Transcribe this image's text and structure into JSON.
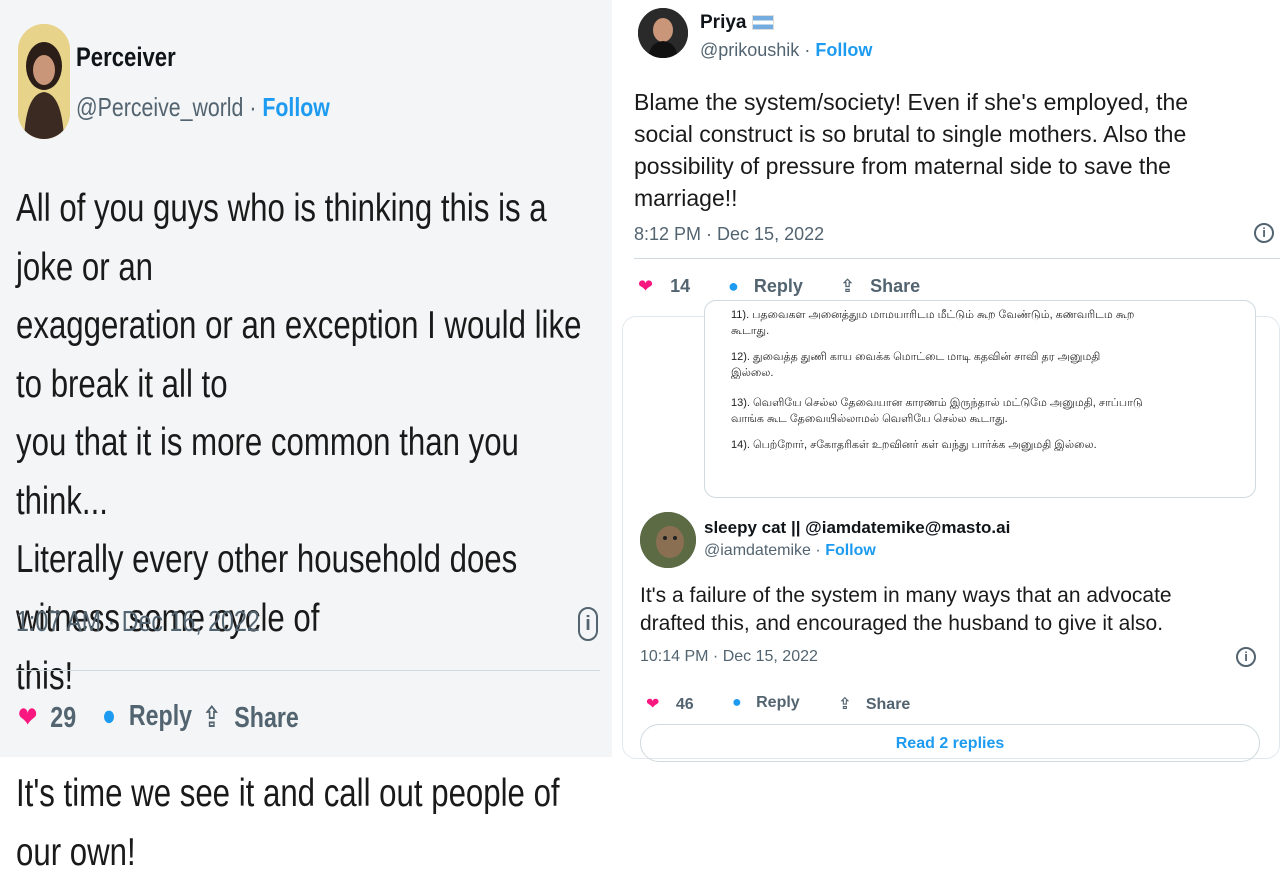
{
  "left_tweet": {
    "author_name": "Perceiver",
    "handle": "@Perceive_world",
    "separator": "·",
    "follow_label": "Follow",
    "body": "All of you guys who is thinking this is a joke or an\nexaggeration or an exception I would like to break it all to\nyou that it is more common than you think...\nLiterally every other household does witness some cycle of\nthis!\n\nIt's time we see it and call out people of our own!",
    "timestamp": "1:07 AM · Dec 16, 2022",
    "likes": "29",
    "reply_label": "Reply",
    "share_label": "Share"
  },
  "right_tweet": {
    "author_name": "Priya",
    "handle": "@prikoushik",
    "separator": "·",
    "follow_label": "Follow",
    "body": "Blame the system/society! Even if she's employed, the\nsocial construct is so brutal to single mothers. Also the\npossibility of pressure from maternal side to save the\nmarriage!!",
    "timestamp": "8:12 PM · Dec 15, 2022",
    "likes": "14",
    "reply_label": "Reply",
    "share_label": "Share"
  },
  "quoted_image": {
    "lines": [
      "11). பதவைகள அனைத்தும மாமயாரிடம மீட்டும் கூற வேண்டும், கணவரிடம கூற",
      "கூடாது.",
      "12). துவைத்த துணி காய வைக்க மொட்டை மாடி கதவின் சாவி தர அனுமதி",
      "இல்லை.",
      "13). வெளியே செல்ல தேவையான காரணம் இருந்தால் மட்டுமே அனுமதி, சாப்பாடு",
      "வாங்க கூட தேவையில்லாமல் வெளியே செல்ல கூடாது.",
      "14). பெற்றோர், சகோதரிகள் உறவினர் கள் வந்து பார்க்க அனுமதி இல்லை."
    ]
  },
  "reply_tweet": {
    "author_name": "sleepy cat || @iamdatemike@masto.ai",
    "handle": "@iamdatemike",
    "separator": "·",
    "follow_label": "Follow",
    "body": "It's a failure of the system in many ways that an advocate\ndrafted this, and encouraged the husband to give it also.",
    "timestamp": "10:14 PM · Dec 15, 2022",
    "likes": "46",
    "reply_label": "Reply",
    "share_label": "Share",
    "read_replies_label": "Read 2 replies"
  },
  "icons": {
    "heart": "heart-icon",
    "reply": "speech-bubble-icon",
    "share": "share-upload-icon",
    "info": "info-icon",
    "flag": "argentina-flag-icon"
  },
  "colors": {
    "accent": "#1d9bf0",
    "like": "#f91880",
    "muted": "#536471"
  }
}
